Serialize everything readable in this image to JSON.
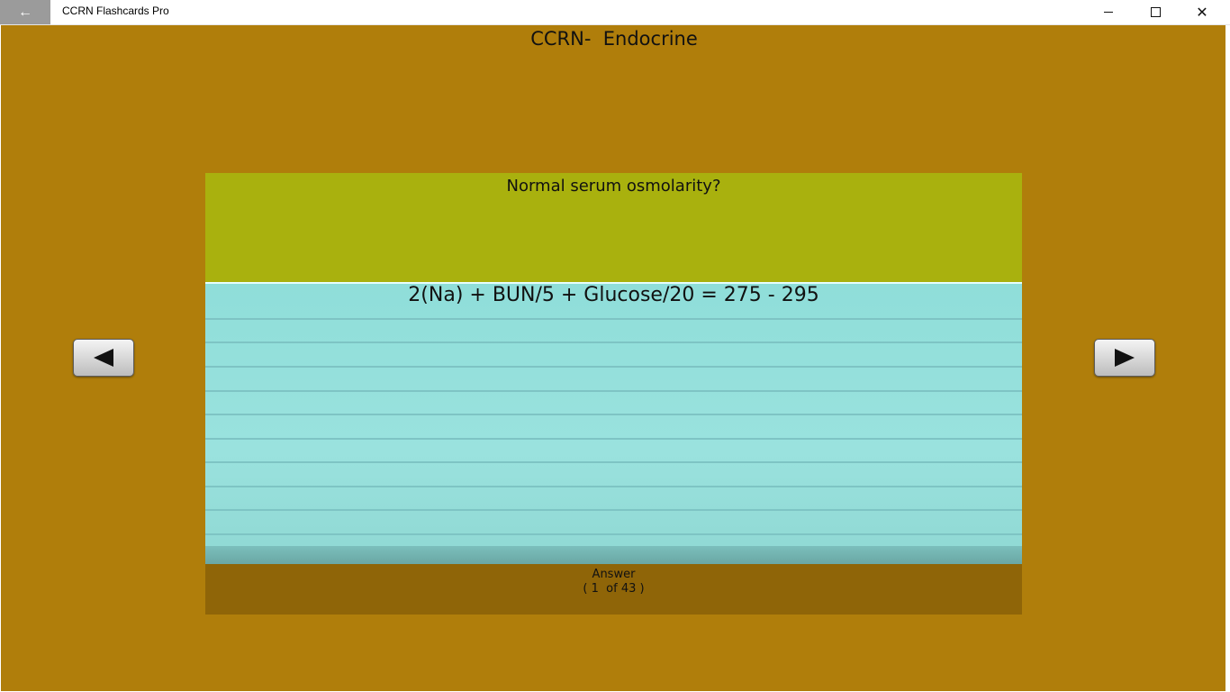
{
  "window": {
    "title": "CCRN Flashcards Pro",
    "back_icon": "←",
    "close_icon": "✕"
  },
  "deck": {
    "title": "CCRN-  Endocrine"
  },
  "card": {
    "question": "Normal serum osmolarity?",
    "answer": "2(Na) + BUN/5 + Glucose/20 = 275 - 295"
  },
  "footer": {
    "label": "Answer",
    "counter": "( 1  of 43 )"
  },
  "colors": {
    "app_background": "#b07e0b",
    "question_background": "#a9b10e",
    "answer_background": "#9ae2de",
    "footer_background": "#8f6508"
  },
  "icons": {
    "prev": "left-arrow-icon",
    "next": "right-arrow-icon"
  }
}
